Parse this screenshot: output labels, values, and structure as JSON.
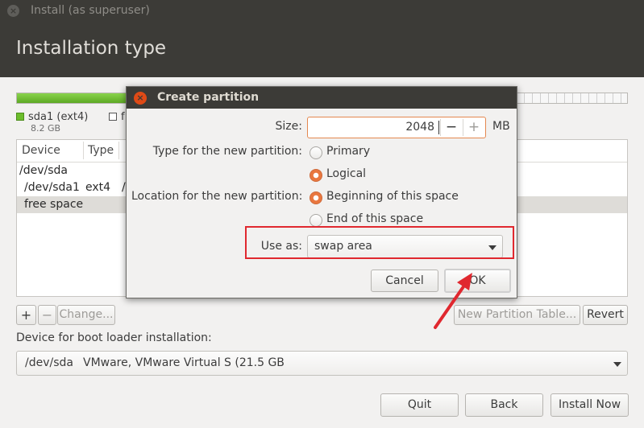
{
  "window": {
    "title": "Install (as superuser)",
    "close_glyph": "×"
  },
  "page": {
    "title": "Installation type"
  },
  "disk_usage": {
    "used_fraction": 0.41,
    "used_color": "#6cbd2c",
    "partitions": [
      {
        "name": "sda1 (ext4)",
        "size": "8.2 GB",
        "color": "#6cbd2c"
      },
      {
        "name": "f",
        "size": "",
        "color": "#ffffff"
      }
    ]
  },
  "table": {
    "headers": [
      "Device",
      "Type",
      ""
    ],
    "rows": [
      {
        "device": "/dev/sda",
        "type": "",
        "mount": ""
      },
      {
        "device": "/dev/sda1",
        "type": "ext4",
        "mount": "/"
      },
      {
        "device": "free space",
        "type": "",
        "mount": ""
      }
    ],
    "selected_row": 2
  },
  "table_actions": {
    "add": "+",
    "remove": "−",
    "change": "Change...",
    "new_table": "New Partition Table...",
    "revert": "Revert"
  },
  "boot_loader": {
    "label": "Device for boot loader installation:",
    "device": "/dev/sda",
    "description": "VMware, VMware Virtual S (21.5 GB"
  },
  "footer": {
    "quit": "Quit",
    "back": "Back",
    "install": "Install Now"
  },
  "dialog": {
    "title": "Create partition",
    "close_glyph": "×",
    "size_label": "Size:",
    "size_value": "2048",
    "size_unit": "MB",
    "stepper_minus": "−",
    "stepper_plus": "+",
    "type_label": "Type for the new partition:",
    "type_options": [
      "Primary",
      "Logical"
    ],
    "type_selected": "Logical",
    "location_label": "Location for the new partition:",
    "location_options": [
      "Beginning of this space",
      "End of this space"
    ],
    "location_selected": "Beginning of this space",
    "use_as_label": "Use as:",
    "use_as_value": "swap area",
    "cancel": "Cancel",
    "ok": "OK"
  },
  "annotation": {
    "color": "#e0282f"
  },
  "colors": {
    "accent": "#e9773f",
    "titlebar": "#3c3b37",
    "window_bg": "#f2f1f0"
  }
}
